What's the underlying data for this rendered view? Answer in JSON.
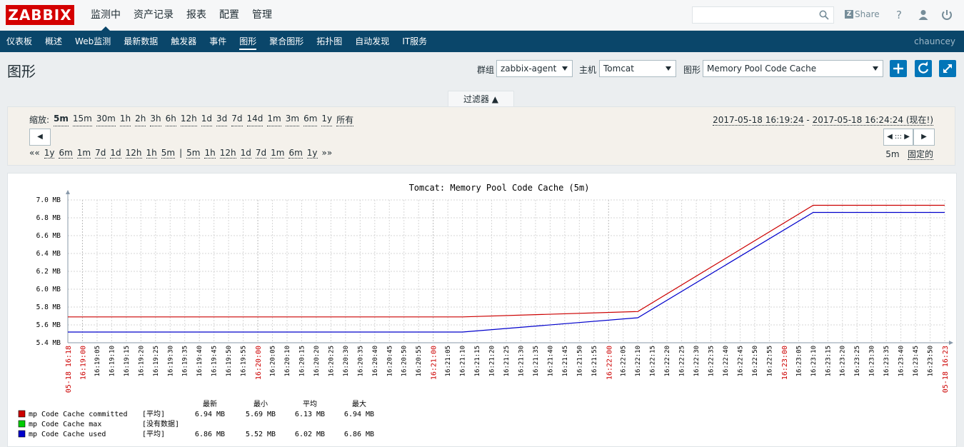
{
  "app": {
    "logo": "ZABBIX"
  },
  "topmenu": [
    "监测中",
    "资产记录",
    "报表",
    "配置",
    "管理"
  ],
  "topbar": {
    "share_label": "Share",
    "help": "?",
    "user_icon": "user-icon",
    "power_icon": "power-icon"
  },
  "nav": {
    "items": [
      "仪表板",
      "概述",
      "Web监测",
      "最新数据",
      "触发器",
      "事件",
      "图形",
      "聚合图形",
      "拓扑图",
      "自动发现",
      "IT服务"
    ],
    "active": "图形",
    "user": "chauncey"
  },
  "page": {
    "title": "图形"
  },
  "filters": {
    "group_label": "群组",
    "group_value": "zabbix-agent",
    "host_label": "主机",
    "host_value": "Tomcat",
    "graph_label": "图形",
    "graph_value": "Memory Pool Code Cache"
  },
  "filter_tab": "过滤器 ▲",
  "timeline": {
    "zoom_label": "缩放:",
    "zoom_options": [
      "5m",
      "15m",
      "30m",
      "1h",
      "2h",
      "3h",
      "6h",
      "12h",
      "1d",
      "3d",
      "7d",
      "14d",
      "1m",
      "3m",
      "6m",
      "1y",
      "所有"
    ],
    "date_from": "2017-05-18 16:19:24",
    "date_sep": " - ",
    "date_to": "2017-05-18 16:24:24 (现在!)",
    "period_back": [
      "«« ",
      "1y",
      "6m",
      "1m",
      "7d",
      "1d",
      "12h",
      "1h",
      "5m",
      "|",
      "5m",
      "1h",
      "12h",
      "1d",
      "7d",
      "1m",
      "6m",
      "1y",
      "»»"
    ],
    "period_value": "5m",
    "fixed_label": "固定的",
    "nav_left": "◀",
    "nav_right": "▶",
    "handle": "◀ ::: ▶"
  },
  "chart_data": {
    "type": "line",
    "title": "Tomcat: Memory Pool Code Cache (5m)",
    "ylim": [
      5.4,
      7.0
    ],
    "yticks": [
      "7.0 MB",
      "6.8 MB",
      "6.6 MB",
      "6.4 MB",
      "6.2 MB",
      "6.0 MB",
      "5.8 MB",
      "5.6 MB",
      "5.4 MB"
    ],
    "x_labels_major": [
      "05-18 16:18",
      "16:19:00",
      "16:20:00",
      "16:21:00",
      "16:22:00",
      "16:23:00",
      "05-18 16:23"
    ],
    "x_labels_minor": [
      "16:19:05",
      "16:19:10",
      "16:19:15",
      "16:19:20",
      "16:19:25",
      "16:19:30",
      "16:19:35",
      "16:19:40",
      "16:19:45",
      "16:19:50",
      "16:19:55",
      "16:20:05",
      "16:20:10",
      "16:20:15",
      "16:20:20",
      "16:20:25",
      "16:20:30",
      "16:20:35",
      "16:20:40",
      "16:20:45",
      "16:20:50",
      "16:20:55",
      "16:21:05",
      "16:21:10",
      "16:21:15",
      "16:21:20",
      "16:21:25",
      "16:21:30",
      "16:21:35",
      "16:21:40",
      "16:21:45",
      "16:21:50",
      "16:21:55",
      "16:22:05",
      "16:22:10",
      "16:22:15",
      "16:22:20",
      "16:22:25",
      "16:22:30",
      "16:22:35",
      "16:22:40",
      "16:22:45",
      "16:22:50",
      "16:22:55",
      "16:23:05",
      "16:23:10",
      "16:23:15",
      "16:23:20",
      "16:23:25",
      "16:23:30",
      "16:23:35",
      "16:23:40",
      "16:23:45",
      "16:23:50"
    ],
    "series": [
      {
        "name": "mp Code Cache committed",
        "color": "#cc0000",
        "points": [
          [
            "16:18:55",
            5.69
          ],
          [
            "16:21:10",
            5.69
          ],
          [
            "16:22:10",
            5.75
          ],
          [
            "16:23:10",
            6.94
          ],
          [
            "16:23:55",
            6.94
          ]
        ]
      },
      {
        "name": "mp Code Cache used",
        "color": "#0000cc",
        "points": [
          [
            "16:18:55",
            5.52
          ],
          [
            "16:21:10",
            5.52
          ],
          [
            "16:22:10",
            5.68
          ],
          [
            "16:23:10",
            6.86
          ],
          [
            "16:23:55",
            6.86
          ]
        ]
      }
    ],
    "legend": {
      "headers": [
        "最新",
        "最小",
        "平均",
        "最大"
      ],
      "rows": [
        {
          "color": "#cc0000",
          "name": "mp Code Cache committed",
          "func": "[平均]",
          "last": "6.94 MB",
          "min": "5.69 MB",
          "avg": "6.13 MB",
          "max": "6.94 MB"
        },
        {
          "color": "#00cc00",
          "name": "mp Code Cache max",
          "func": "[没有数据]",
          "last": "",
          "min": "",
          "avg": "",
          "max": ""
        },
        {
          "color": "#0000cc",
          "name": "mp Code Cache used",
          "func": "[平均]",
          "last": "6.86 MB",
          "min": "5.52 MB",
          "avg": "6.02 MB",
          "max": "6.86 MB"
        }
      ]
    }
  }
}
